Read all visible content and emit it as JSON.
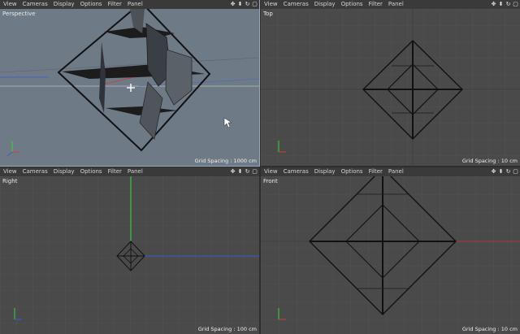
{
  "menu": [
    "View",
    "Cameras",
    "Display",
    "Options",
    "Filter",
    "Panel"
  ],
  "nav_icons": [
    "move-view-icon",
    "zoom-view-icon",
    "rotate-view-icon",
    "maximize-view-icon"
  ],
  "viewports": {
    "perspective": {
      "label": "Perspective",
      "grid_spacing": "Grid Spacing : 1000 cm"
    },
    "top": {
      "label": "Top",
      "grid_spacing": "Grid Spacing : 10 cm"
    },
    "right": {
      "label": "Right",
      "grid_spacing": "Grid Spacing : 100 cm"
    },
    "front": {
      "label": "Front",
      "grid_spacing": "Grid Spacing : 10 cm"
    }
  },
  "colors": {
    "viewport_bg": "#4a4a4a",
    "perspective_bg": "#6f7a87",
    "axis_x": "#d23a3a",
    "axis_y": "#3ad23a",
    "axis_z": "#3a5ad2"
  }
}
